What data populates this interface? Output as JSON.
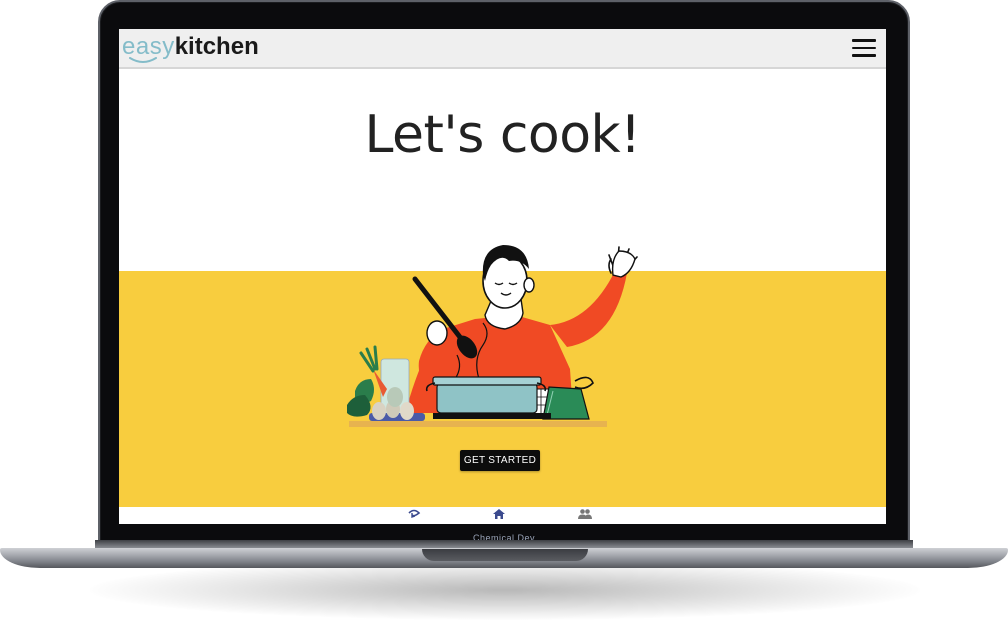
{
  "app": {
    "logo_part_a": "easy",
    "logo_part_b": "kitchen",
    "menu_icon": "hamburger-menu-icon"
  },
  "hero": {
    "title": "Let's cook!",
    "cta_label": "GET STARTED"
  },
  "bottom_nav": {
    "items": [
      {
        "icon": "rotate-arrow-icon"
      },
      {
        "icon": "home-icon",
        "active": true
      },
      {
        "icon": "people-icon"
      }
    ]
  },
  "device": {
    "lid_label": "Chemical Dev"
  },
  "colors": {
    "appbar": "#efefef",
    "band": "#f8cd3e",
    "accent_nav": "#3b4a8e",
    "logo_accent": "#84bcc9",
    "shirt": "#f04a24",
    "pot": "#8fc3c6",
    "cta_bg": "#0c0c0c"
  }
}
